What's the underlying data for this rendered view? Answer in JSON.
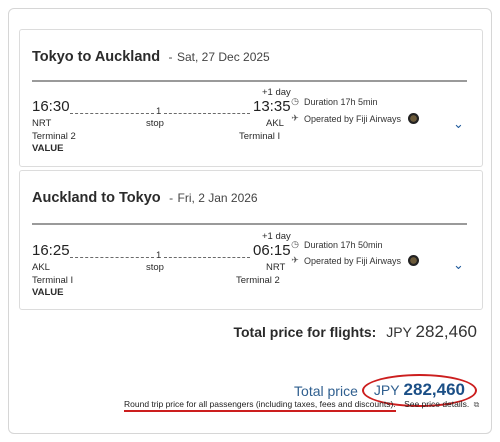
{
  "flights": [
    {
      "route": "Tokyo to Auckland",
      "separator": "-",
      "date": "Sat, 27 Dec 2025",
      "depart_time": "16:30",
      "arrive_time": "13:35",
      "day_offset": "+1 day",
      "stops_count": "1",
      "stops_label": "stop",
      "origin_code": "NRT",
      "dest_code": "AKL",
      "origin_terminal": "Terminal 2",
      "dest_terminal": "Terminal I",
      "fare": "VALUE",
      "duration": "Duration 17h 5min",
      "operator": "Operated by Fiji Airways"
    },
    {
      "route": "Auckland to Tokyo",
      "separator": "-",
      "date": "Fri, 2 Jan 2026",
      "depart_time": "16:25",
      "arrive_time": "06:15",
      "day_offset": "+1 day",
      "stops_count": "1",
      "stops_label": "stop",
      "origin_code": "AKL",
      "dest_code": "NRT",
      "origin_terminal": "Terminal I",
      "dest_terminal": "Terminal 2",
      "fare": "VALUE",
      "duration": "Duration 17h 50min",
      "operator": "Operated by Fiji Airways"
    }
  ],
  "totals": {
    "flights_label": "Total price for flights:",
    "flights_currency": "JPY",
    "flights_value": "282,460",
    "total_label": "Total price",
    "total_currency": "JPY",
    "total_value": "282,460",
    "footnote": "Round trip price for all passengers (including taxes, fees and discounts).",
    "price_details_link": "See price details."
  },
  "colors": {
    "accent_blue": "#1b4f86",
    "highlight_red": "#cc1e1e"
  },
  "icons": {
    "duration": "clock-icon",
    "operator": "plane-icon",
    "airline_logo": "fiji-airways-logo",
    "expand": "chevron-down-icon",
    "external": "external-link-icon"
  }
}
